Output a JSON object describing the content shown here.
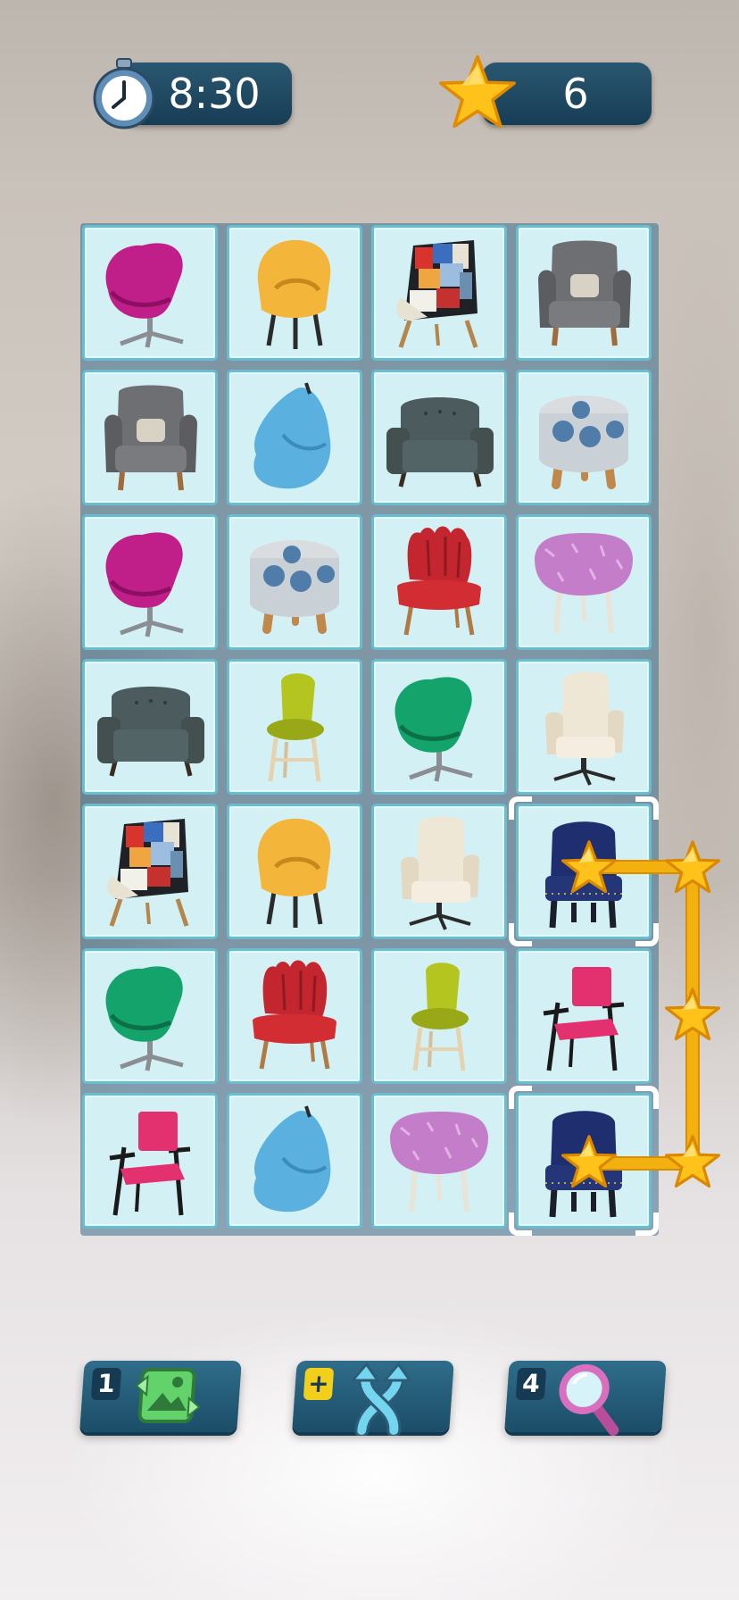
{
  "hud": {
    "timer": "8:30",
    "stars": "6",
    "timer_icon": "stopwatch-icon",
    "star_icon": "star-icon"
  },
  "board": {
    "rows": [
      [
        "magenta-egg-chair",
        "yellow-shell-chair",
        "patchwork-wingback-chair",
        "gray-wingback-chair"
      ],
      [
        "gray-wingback-chair",
        "blue-bean-bag",
        "gray-armchair",
        "polka-ottoman"
      ],
      [
        "magenta-egg-chair",
        "polka-ottoman",
        "red-scallop-chair",
        "purple-fur-stool"
      ],
      [
        "gray-armchair",
        "lime-bar-stool",
        "green-egg-chair",
        "cream-office-chair"
      ],
      [
        "patchwork-wingback-chair",
        "yellow-shell-chair",
        "cream-office-chair",
        "navy-velvet-chair"
      ],
      [
        "green-egg-chair",
        "red-scallop-chair",
        "lime-bar-stool",
        "pink-frame-chair"
      ],
      [
        "pink-frame-chair",
        "blue-bean-bag",
        "purple-fur-stool",
        "navy-velvet-chair"
      ]
    ],
    "selected": [
      [
        4,
        3
      ],
      [
        6,
        3
      ]
    ]
  },
  "tools": [
    {
      "count": "1",
      "icon": "shuffle-image-icon"
    },
    {
      "count": "+",
      "icon": "swap-arrows-icon"
    },
    {
      "count": "4",
      "icon": "magnifier-hint-icon"
    }
  ],
  "colors": {
    "tile_bg": "#d3f1f4",
    "tile_border": "#68bdd0",
    "hud_bg": "#173d55",
    "path": "#f3b110",
    "star": "#ffc21a"
  }
}
